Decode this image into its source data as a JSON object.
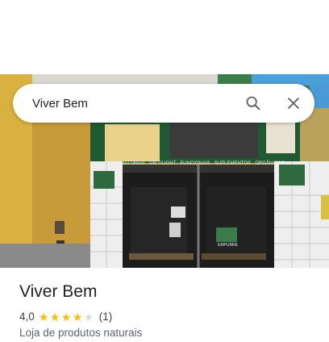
{
  "search": {
    "value": "Viver Bem",
    "search_icon": "search-icon",
    "close_icon": "close-icon"
  },
  "photo": {
    "subject": "storefront",
    "sign_text": "NATURAIS · DIET/LIGHT · FUNCIONAIS · SUPLEMENTOS · ORGÂNICOS",
    "door_sign": "EMPURRE"
  },
  "place": {
    "name": "Viver Bem",
    "rating": "4,0",
    "stars_filled": 4,
    "stars_total": 5,
    "review_count": "(1)",
    "category": "Loja de produtos naturais"
  },
  "colors": {
    "star": "#fbbc04",
    "star_empty": "#dadce0"
  }
}
